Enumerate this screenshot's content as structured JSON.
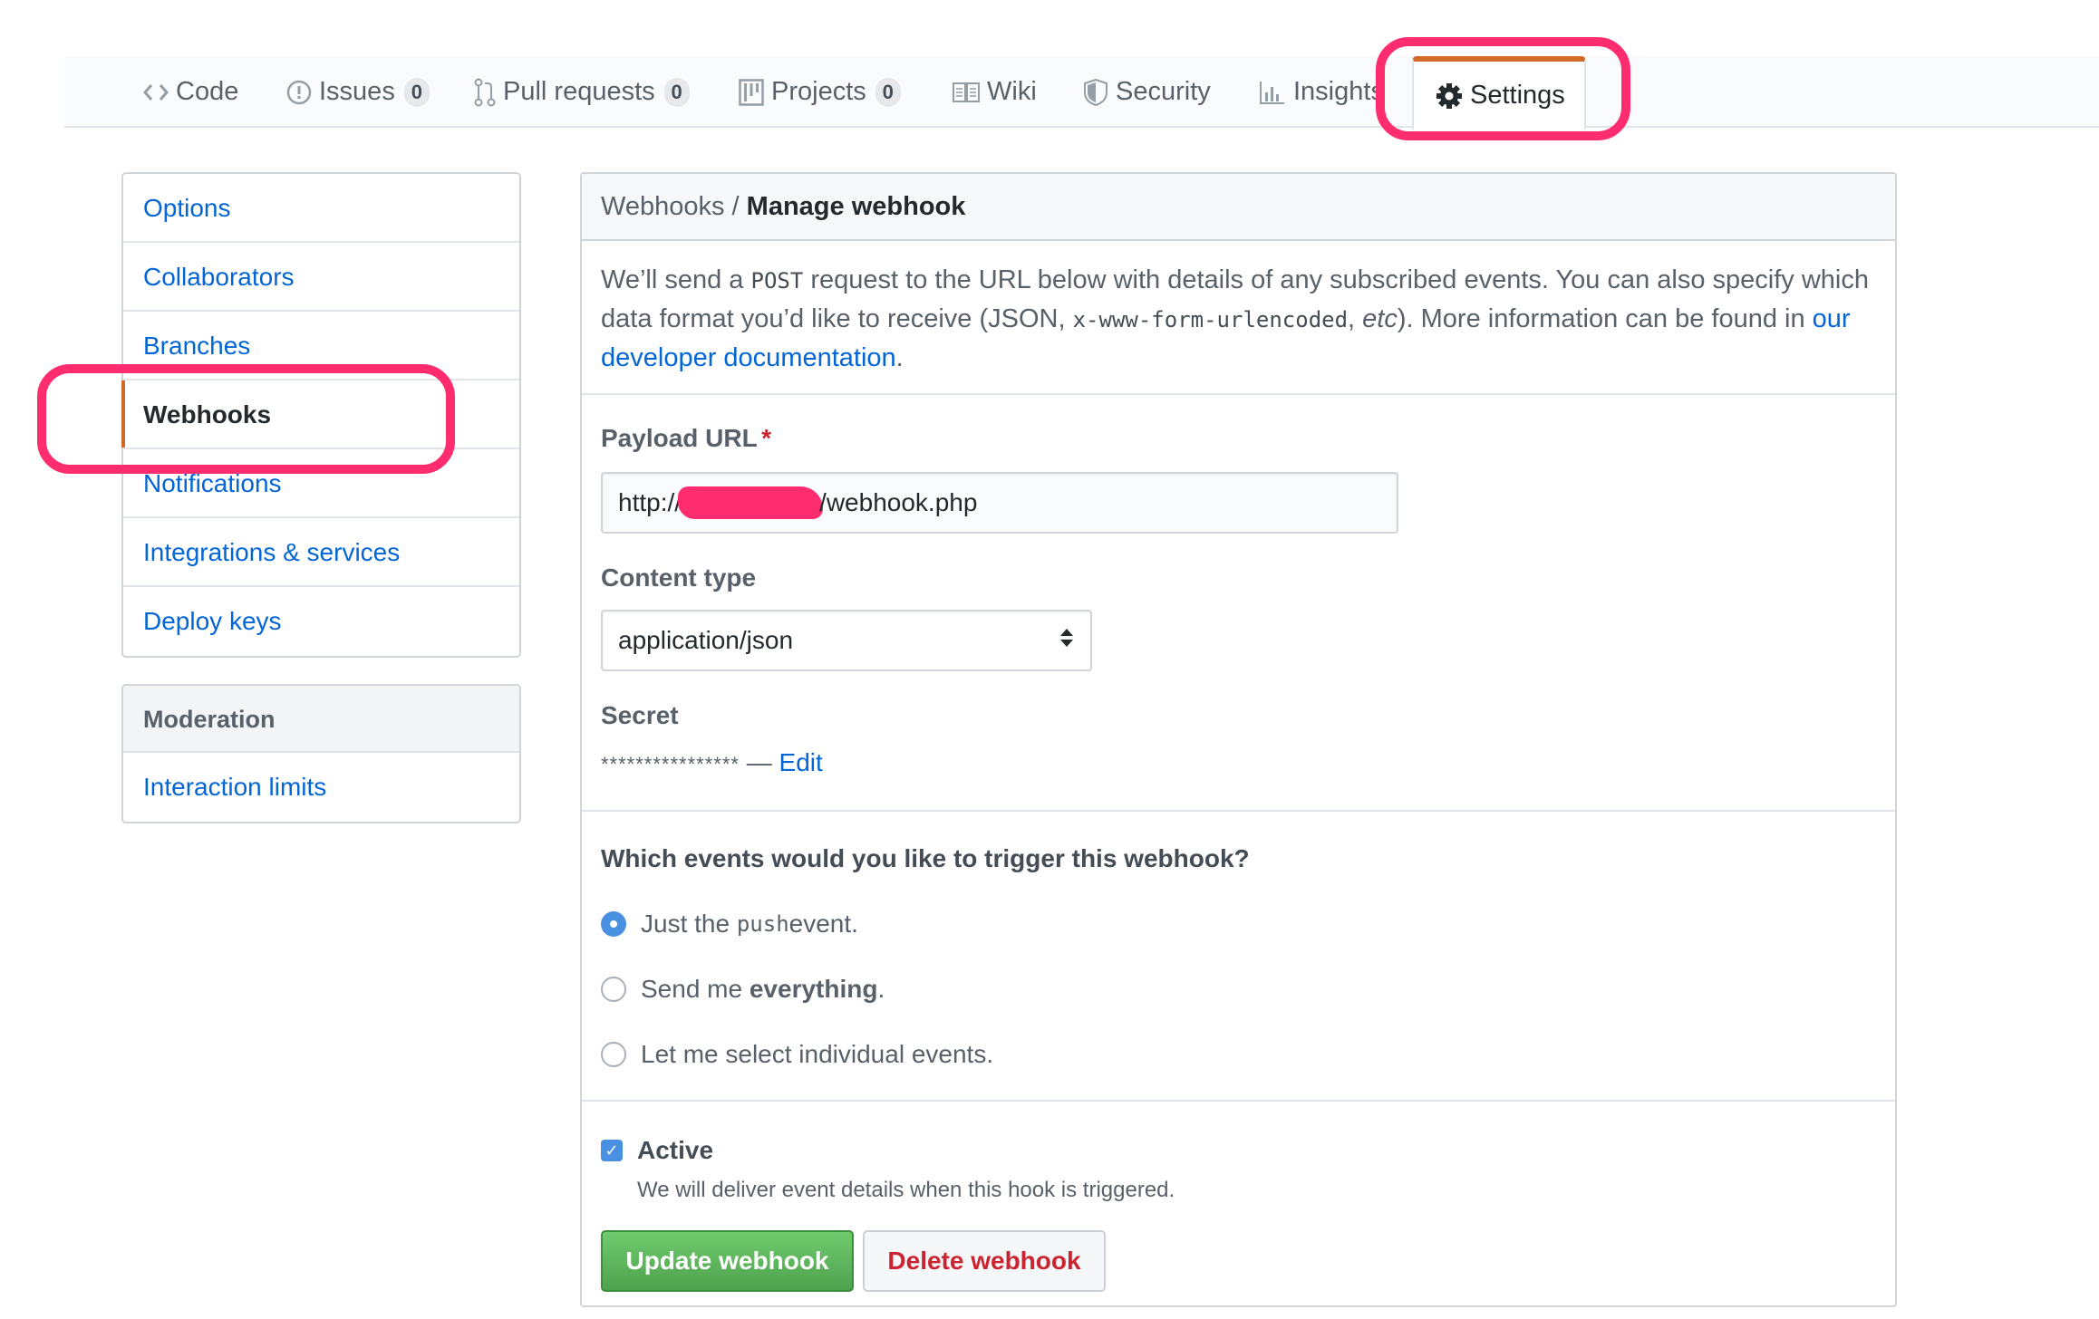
{
  "tabs": [
    {
      "label": "Code",
      "icon": "code-icon",
      "count": null
    },
    {
      "label": "Issues",
      "icon": "issue-icon",
      "count": "0"
    },
    {
      "label": "Pull requests",
      "icon": "pull-request-icon",
      "count": "0"
    },
    {
      "label": "Projects",
      "icon": "project-icon",
      "count": "0"
    },
    {
      "label": "Wiki",
      "icon": "book-icon",
      "count": null
    },
    {
      "label": "Security",
      "icon": "shield-icon",
      "count": null
    },
    {
      "label": "Insights",
      "icon": "graph-icon",
      "count": null
    },
    {
      "label": "Settings",
      "icon": "gear-icon",
      "count": null,
      "selected": true
    }
  ],
  "sidebar": {
    "items": [
      {
        "label": "Options"
      },
      {
        "label": "Collaborators"
      },
      {
        "label": "Branches"
      },
      {
        "label": "Webhooks",
        "selected": true
      },
      {
        "label": "Notifications"
      },
      {
        "label": "Integrations & services"
      },
      {
        "label": "Deploy keys"
      }
    ],
    "moderation": {
      "heading": "Moderation",
      "items": [
        {
          "label": "Interaction limits"
        }
      ]
    }
  },
  "main": {
    "breadcrumb_parent": "Webhooks",
    "breadcrumb_sep": " / ",
    "title": "Manage webhook",
    "intro": {
      "part1": "We’ll send a ",
      "code1": "POST",
      "part2": " request to the URL below with details of any subscribed events. You can also specify which data format you’d like to receive (JSON, ",
      "code2": "x-www-form-urlencoded",
      "part3": ", ",
      "italic": "etc",
      "part4": "). More information can be found in ",
      "link": "our developer documentation",
      "part5": "."
    },
    "payload_url": {
      "label": "Payload URL",
      "required_mark": "*",
      "value_prefix": "http://",
      "value_suffix": "/webhook.php"
    },
    "content_type": {
      "label": "Content type",
      "selected": "application/json"
    },
    "secret": {
      "label": "Secret",
      "masked": "****************",
      "dash": " — ",
      "edit": "Edit"
    },
    "events": {
      "question": "Which events would you like to trigger this webhook?",
      "options": [
        {
          "pre": "Just the ",
          "code": "push",
          "post": " event.",
          "bold": "",
          "checked": true
        },
        {
          "pre": "Send me ",
          "code": "",
          "post": ".",
          "bold": "everything",
          "checked": false
        },
        {
          "pre": "Let me select individual events.",
          "code": "",
          "post": "",
          "bold": "",
          "checked": false
        }
      ]
    },
    "active": {
      "label": "Active",
      "checked": true,
      "note": "We will deliver event details when this hook is triggered."
    },
    "buttons": {
      "update": "Update webhook",
      "delete": "Delete webhook"
    }
  },
  "colors": {
    "accent": "#d26a2a",
    "link": "#0366d6",
    "annotation": "#ff2d6f",
    "primary_button": "#4fa24e",
    "danger_text": "#cb2431"
  }
}
